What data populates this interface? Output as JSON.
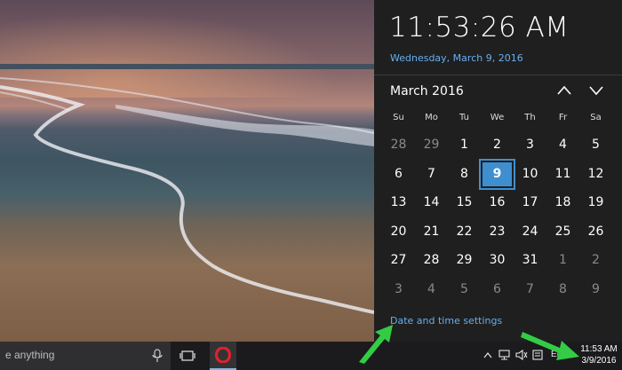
{
  "search": {
    "placeholder": "e anything"
  },
  "taskbar": {
    "tray_lang": "ENG",
    "clock_time": "11:53 AM",
    "clock_date": "3/9/2016"
  },
  "panel": {
    "time": "11:53:26 AM",
    "date": "Wednesday, March 9, 2016",
    "month_label": "March 2016",
    "weekdays": [
      "Su",
      "Mo",
      "Tu",
      "We",
      "Th",
      "Fr",
      "Sa"
    ],
    "weeks": [
      [
        "28",
        "29",
        "1",
        "2",
        "3",
        "4",
        "5"
      ],
      [
        "6",
        "7",
        "8",
        "9",
        "10",
        "11",
        "12"
      ],
      [
        "13",
        "14",
        "15",
        "16",
        "17",
        "18",
        "19"
      ],
      [
        "20",
        "21",
        "22",
        "23",
        "24",
        "25",
        "26"
      ],
      [
        "27",
        "28",
        "29",
        "30",
        "31",
        "1",
        "2"
      ],
      [
        "3",
        "4",
        "5",
        "6",
        "7",
        "8",
        "9"
      ]
    ],
    "selected_day": "9",
    "settings_link": "Date and time settings"
  },
  "colors": {
    "accent": "#3f8fd0",
    "link": "#67aef0",
    "arrow": "#33cc44"
  }
}
